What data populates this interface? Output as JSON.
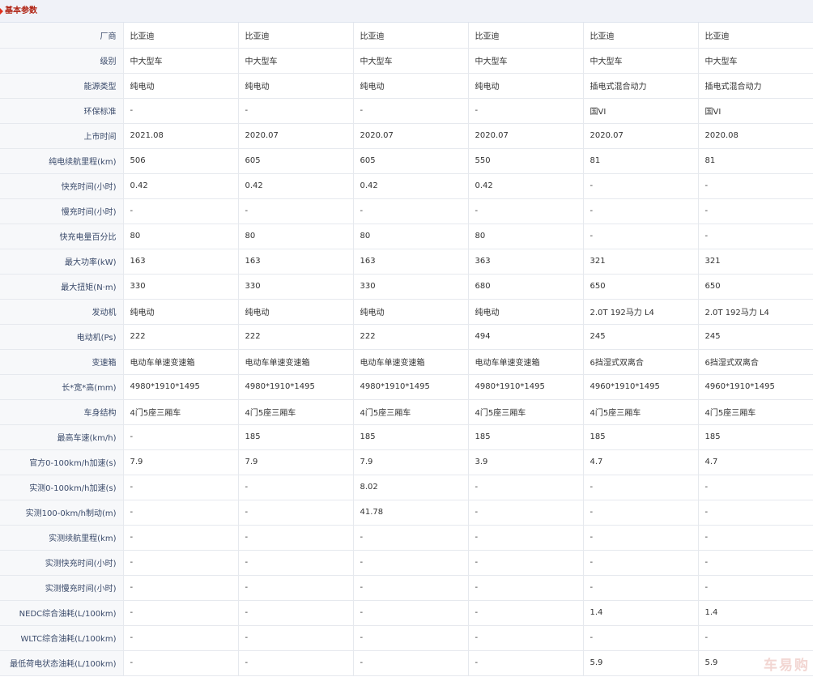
{
  "section": {
    "title": "基本参数",
    "arrow_color": "#e0301e"
  },
  "rows": [
    {
      "label": "厂商",
      "values": [
        "比亚迪",
        "比亚迪",
        "比亚迪",
        "比亚迪",
        "比亚迪",
        "比亚迪"
      ]
    },
    {
      "label": "级别",
      "values": [
        "中大型车",
        "中大型车",
        "中大型车",
        "中大型车",
        "中大型车",
        "中大型车"
      ]
    },
    {
      "label": "能源类型",
      "values": [
        "纯电动",
        "纯电动",
        "纯电动",
        "纯电动",
        "插电式混合动力",
        "插电式混合动力"
      ]
    },
    {
      "label": "环保标准",
      "values": [
        "-",
        "-",
        "-",
        "-",
        "国VI",
        "国VI"
      ]
    },
    {
      "label": "上市时间",
      "values": [
        "2021.08",
        "2020.07",
        "2020.07",
        "2020.07",
        "2020.07",
        "2020.08"
      ]
    },
    {
      "label": "纯电续航里程(km)",
      "values": [
        "506",
        "605",
        "605",
        "550",
        "81",
        "81"
      ]
    },
    {
      "label": "快充时间(小时)",
      "values": [
        "0.42",
        "0.42",
        "0.42",
        "0.42",
        "-",
        "-"
      ]
    },
    {
      "label": "慢充时间(小时)",
      "values": [
        "-",
        "-",
        "-",
        "-",
        "-",
        "-"
      ]
    },
    {
      "label": "快充电量百分比",
      "values": [
        "80",
        "80",
        "80",
        "80",
        "-",
        "-"
      ]
    },
    {
      "label": "最大功率(kW)",
      "values": [
        "163",
        "163",
        "163",
        "363",
        "321",
        "321"
      ]
    },
    {
      "label": "最大扭矩(N·m)",
      "values": [
        "330",
        "330",
        "330",
        "680",
        "650",
        "650"
      ]
    },
    {
      "label": "发动机",
      "values": [
        "纯电动",
        "纯电动",
        "纯电动",
        "纯电动",
        "2.0T 192马力 L4",
        "2.0T 192马力 L4"
      ]
    },
    {
      "label": "电动机(Ps)",
      "values": [
        "222",
        "222",
        "222",
        "494",
        "245",
        "245"
      ]
    },
    {
      "label": "变速箱",
      "values": [
        "电动车单速变速箱",
        "电动车单速变速箱",
        "电动车单速变速箱",
        "电动车单速变速箱",
        "6挡湿式双离合",
        "6挡湿式双离合"
      ]
    },
    {
      "label": "长*宽*高(mm)",
      "values": [
        "4980*1910*1495",
        "4980*1910*1495",
        "4980*1910*1495",
        "4980*1910*1495",
        "4960*1910*1495",
        "4960*1910*1495"
      ]
    },
    {
      "label": "车身结构",
      "values": [
        "4门5座三厢车",
        "4门5座三厢车",
        "4门5座三厢车",
        "4门5座三厢车",
        "4门5座三厢车",
        "4门5座三厢车"
      ]
    },
    {
      "label": "最高车速(km/h)",
      "values": [
        "-",
        "185",
        "185",
        "185",
        "185",
        "185"
      ]
    },
    {
      "label": "官方0-100km/h加速(s)",
      "values": [
        "7.9",
        "7.9",
        "7.9",
        "3.9",
        "4.7",
        "4.7"
      ]
    },
    {
      "label": "实测0-100km/h加速(s)",
      "values": [
        "-",
        "-",
        "8.02",
        "-",
        "-",
        "-"
      ]
    },
    {
      "label": "实测100-0km/h制动(m)",
      "values": [
        "-",
        "-",
        "41.78",
        "-",
        "-",
        "-"
      ]
    },
    {
      "label": "实测续航里程(km)",
      "values": [
        "-",
        "-",
        "-",
        "-",
        "-",
        "-"
      ]
    },
    {
      "label": "实测快充时间(小时)",
      "values": [
        "-",
        "-",
        "-",
        "-",
        "-",
        "-"
      ]
    },
    {
      "label": "实测慢充时间(小时)",
      "values": [
        "-",
        "-",
        "-",
        "-",
        "-",
        "-"
      ]
    },
    {
      "label": "NEDC综合油耗(L/100km)",
      "values": [
        "-",
        "-",
        "-",
        "-",
        "1.4",
        "1.4"
      ]
    },
    {
      "label": "WLTC综合油耗(L/100km)",
      "values": [
        "-",
        "-",
        "-",
        "-",
        "-",
        "-"
      ]
    },
    {
      "label": "最低荷电状态油耗(L/100km)",
      "values": [
        "-",
        "-",
        "-",
        "-",
        "5.9",
        "5.9"
      ]
    }
  ],
  "watermark": "车易购"
}
